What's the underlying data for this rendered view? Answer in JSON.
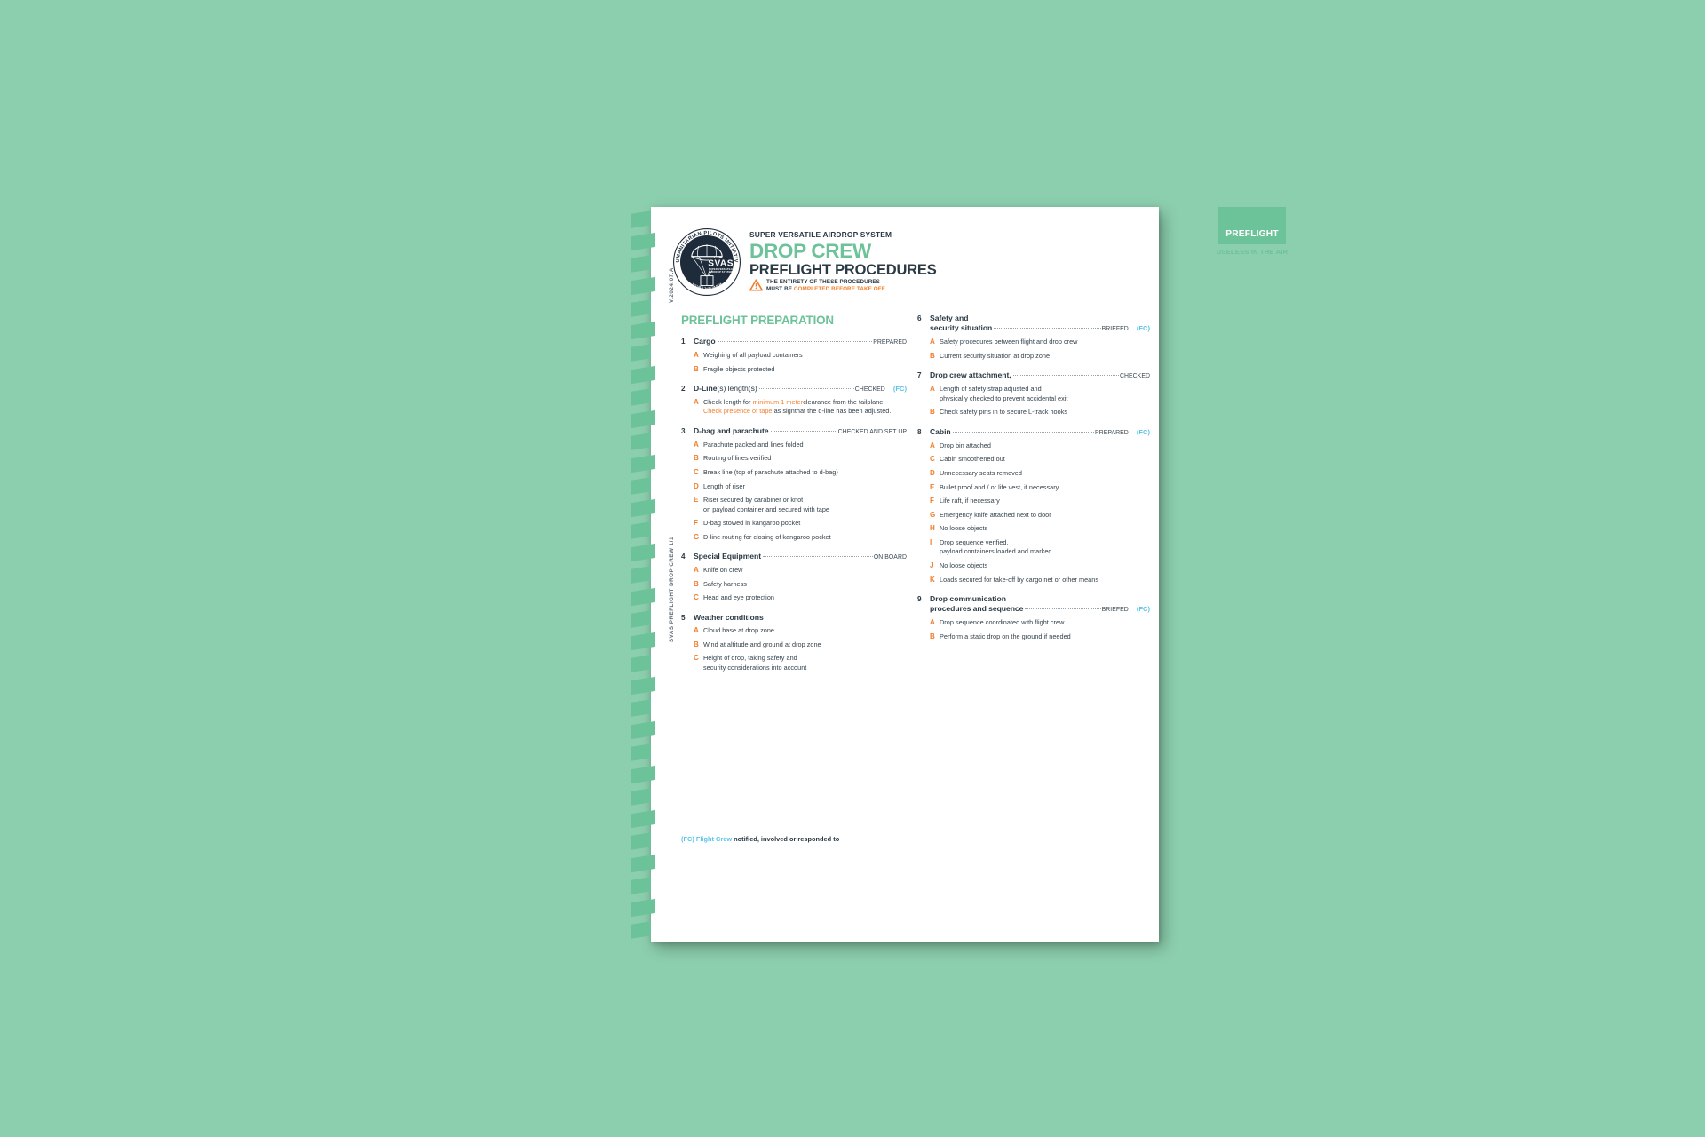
{
  "meta": {
    "background_color": "#8ccfae",
    "accent_green": "#6cc299",
    "accent_orange": "#ef7f2e",
    "accent_blue": "#59c3e8",
    "ink": "#2b3a45"
  },
  "edge": {
    "version_label": "V.2024.07.A",
    "spine_label": "SVAS PREFLIGHT DROP CREW 1/1"
  },
  "header": {
    "logo_name": "svas-logo",
    "logo_ring_text": "HUMANITARIAN PILOTS INITIATIVE",
    "logo_mark": "SVAS",
    "logo_submark_1": "SUPER VERSATILE",
    "logo_submark_2": "AIRDROP SYSTEM",
    "logo_url_text": "WWW.HPI.SWISS",
    "kicker": "SUPER VERSATILE AIRDROP SYSTEM",
    "title_primary": "DROP CREW",
    "title_secondary": "PREFLIGHT PROCEDURES",
    "warning_icon": "warning-triangle-icon",
    "warning_line1": "THE ENTIRETY OF THESE PROCEDURES",
    "warning_line2_prefix": "MUST BE ",
    "warning_line2_highlight": "COMPLETED BEFORE TAKE OFF",
    "badge_label": "PREFLIGHT",
    "badge_sublabel": "USELESS IN THE AIR"
  },
  "section_title": "PREFLIGHT PREPARATION",
  "footnote": {
    "tag": "(FC) Flight Crew",
    "rest": " notified, involved or responded to"
  },
  "left_column": [
    {
      "number": "1",
      "label": "Cargo",
      "label_light": "",
      "value": "PREPARED",
      "fc": "",
      "subs": [
        {
          "letter": "A",
          "lines": [
            {
              "text": "Weighing of all payload containers",
              "highlight": false
            }
          ]
        },
        {
          "letter": "B",
          "lines": [
            {
              "text": "Fragile objects protected",
              "highlight": false
            }
          ]
        }
      ]
    },
    {
      "number": "2",
      "label": "D-Line",
      "label_light": "(s) length(s)",
      "value": "CHECKED",
      "fc": "(FC)",
      "subs": [
        {
          "letter": "A",
          "lines": [
            {
              "text": "Check length for ",
              "highlight": false,
              "inline": true
            },
            {
              "text": "minimum 1 meter",
              "highlight": true,
              "inline": true
            },
            {
              "text": "clearance from the tailplane.",
              "highlight": false
            },
            {
              "text": "Check presence of tape",
              "highlight": true,
              "inline": true
            },
            {
              "text": " as sign",
              "highlight": false,
              "inline": true
            },
            {
              "text": "that the d-line has been adjusted.",
              "highlight": false
            }
          ]
        }
      ]
    },
    {
      "number": "3",
      "label": "D-bag and parachute",
      "label_light": "",
      "value": "CHECKED AND SET UP",
      "fc": "",
      "subs": [
        {
          "letter": "A",
          "lines": [
            {
              "text": "Parachute packed and lines folded",
              "highlight": false
            }
          ]
        },
        {
          "letter": "B",
          "lines": [
            {
              "text": "Routing of lines verified",
              "highlight": false
            }
          ]
        },
        {
          "letter": "C",
          "lines": [
            {
              "text": "Break line (top of parachute attached to d-bag)",
              "highlight": false
            }
          ]
        },
        {
          "letter": "D",
          "lines": [
            {
              "text": "Length of riser",
              "highlight": false
            }
          ]
        },
        {
          "letter": "E",
          "lines": [
            {
              "text": "Riser secured by carabiner or knot",
              "highlight": false
            },
            {
              "text": "on payload container and secured with tape",
              "highlight": false
            }
          ]
        },
        {
          "letter": "F",
          "lines": [
            {
              "text": "D-bag stowed in kangaroo pocket",
              "highlight": false
            }
          ]
        },
        {
          "letter": "G",
          "lines": [
            {
              "text": "D-line routing for closing of kangaroo pocket",
              "highlight": false
            }
          ]
        }
      ]
    },
    {
      "number": "4",
      "label": "Special Equipment",
      "label_light": "",
      "value": "ON BOARD",
      "fc": "",
      "subs": [
        {
          "letter": "A",
          "lines": [
            {
              "text": "Knife on crew",
              "highlight": false
            }
          ]
        },
        {
          "letter": "B",
          "lines": [
            {
              "text": "Safety harness",
              "highlight": false
            }
          ]
        },
        {
          "letter": "C",
          "lines": [
            {
              "text": "Head and eye protection",
              "highlight": false
            }
          ]
        }
      ]
    },
    {
      "number": "5",
      "label": "Weather conditions",
      "label_light": "",
      "value": "",
      "fc": "",
      "subs": [
        {
          "letter": "A",
          "lines": [
            {
              "text": "Cloud base at drop zone",
              "highlight": false
            }
          ]
        },
        {
          "letter": "B",
          "lines": [
            {
              "text": "Wind at altitude and ground at drop zone",
              "highlight": false
            }
          ]
        },
        {
          "letter": "C",
          "lines": [
            {
              "text": "Height of drop, taking safety and",
              "highlight": false
            },
            {
              "text": "security considerations into account",
              "highlight": false
            }
          ]
        }
      ]
    }
  ],
  "right_column": [
    {
      "number": "6",
      "label": "Safety and",
      "label_line2": "security situation",
      "label_light": "",
      "value": "BRIEFED",
      "fc": "(FC)",
      "subs": [
        {
          "letter": "A",
          "lines": [
            {
              "text": "Safety procedures between flight and drop crew",
              "highlight": false
            }
          ]
        },
        {
          "letter": "B",
          "lines": [
            {
              "text": "Current security situation at drop zone",
              "highlight": false
            }
          ]
        }
      ]
    },
    {
      "number": "7",
      "label": "Drop crew attachment,",
      "label_light": "",
      "value": "CHECKED",
      "fc": "",
      "subs": [
        {
          "letter": "A",
          "lines": [
            {
              "text": "Length of safety strap adjusted and",
              "highlight": false
            },
            {
              "text": "physically checked to prevent accidental exit",
              "highlight": false
            }
          ]
        },
        {
          "letter": "B",
          "lines": [
            {
              "text": "Check safety pins in to secure L-track hooks",
              "highlight": false
            }
          ]
        }
      ]
    },
    {
      "number": "8",
      "label": "Cabin",
      "label_light": "",
      "value": "PREPARED",
      "fc": "(FC)",
      "subs": [
        {
          "letter": "A",
          "lines": [
            {
              "text": "Drop bin attached",
              "highlight": false
            }
          ]
        },
        {
          "letter": "C",
          "lines": [
            {
              "text": "Cabin smoothened out",
              "highlight": false
            }
          ]
        },
        {
          "letter": "D",
          "lines": [
            {
              "text": "Unnecessary seats removed",
              "highlight": false
            }
          ]
        },
        {
          "letter": "E",
          "lines": [
            {
              "text": "Bullet proof and / or life vest, if necessary",
              "highlight": false
            }
          ]
        },
        {
          "letter": "F",
          "lines": [
            {
              "text": "Life raft, if necessary",
              "highlight": false
            }
          ]
        },
        {
          "letter": "G",
          "lines": [
            {
              "text": "Emergency knife attached next to door",
              "highlight": false
            }
          ]
        },
        {
          "letter": "H",
          "lines": [
            {
              "text": "No loose objects",
              "highlight": false
            }
          ]
        },
        {
          "letter": "I",
          "lines": [
            {
              "text": "Drop sequence verified,",
              "highlight": false
            },
            {
              "text": "payload containers loaded and marked",
              "highlight": false
            }
          ]
        },
        {
          "letter": "J",
          "lines": [
            {
              "text": "No loose objects",
              "highlight": false
            }
          ]
        },
        {
          "letter": "K",
          "lines": [
            {
              "text": "Loads secured for take-off by cargo net or other means",
              "highlight": false
            }
          ]
        }
      ]
    },
    {
      "number": "9",
      "label": "Drop communication",
      "label_line2": "procedures and sequence",
      "label_light": "",
      "value": "BRIEFED",
      "fc": "(FC)",
      "subs": [
        {
          "letter": "A",
          "lines": [
            {
              "text": "Drop sequence coordinated with flight crew",
              "highlight": false
            }
          ]
        },
        {
          "letter": "B",
          "lines": [
            {
              "text": "Perform a static drop on the ground if needed",
              "highlight": false
            }
          ]
        }
      ]
    }
  ]
}
